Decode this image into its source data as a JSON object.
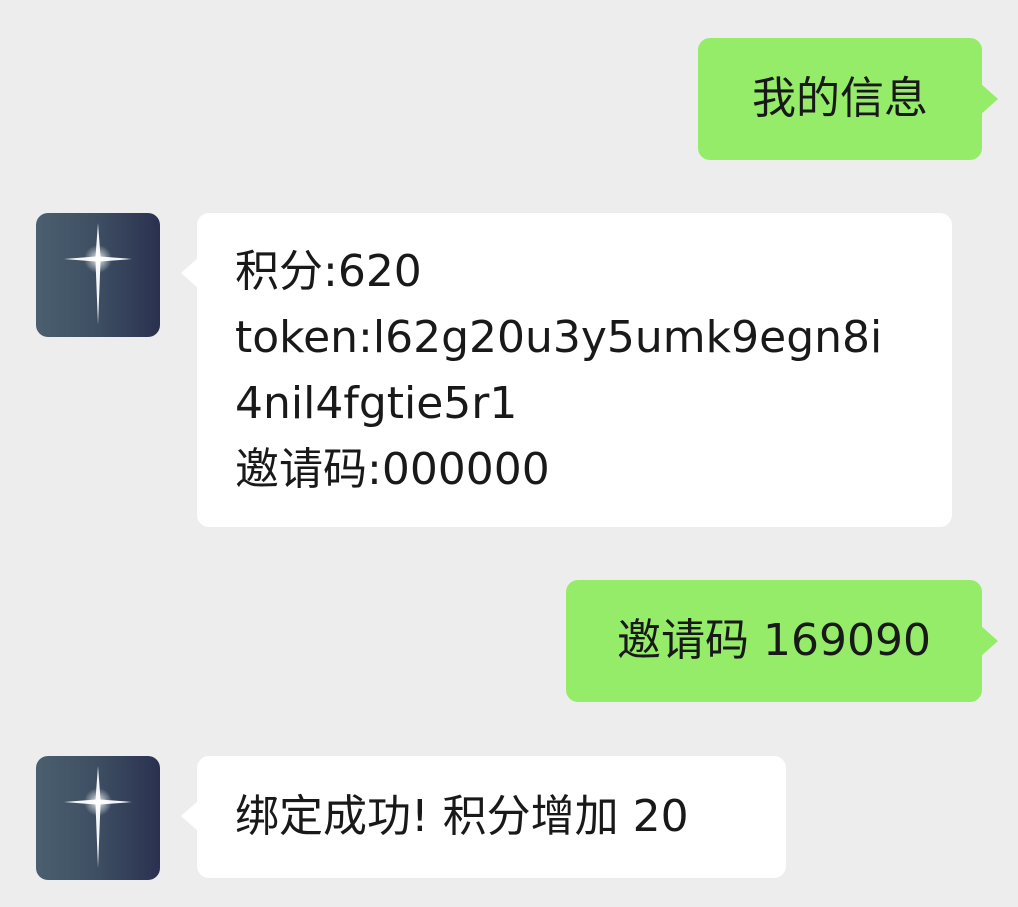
{
  "chat": {
    "messages": [
      {
        "sender": "self",
        "text": "我的信息"
      },
      {
        "sender": "bot",
        "avatar_icon": "sparkle-star-icon",
        "lines": [
          "积分:620",
          "token:l62g20u3y5umk9egn8i",
          "4nil4fgtie5r1",
          "邀请码:000000"
        ]
      },
      {
        "sender": "self",
        "text": "邀请码 169090"
      },
      {
        "sender": "bot",
        "avatar_icon": "sparkle-star-icon",
        "text": "绑定成功! 积分增加 20"
      }
    ]
  },
  "colors": {
    "background": "#ededed",
    "self_bubble": "#95ec69",
    "bot_bubble": "#ffffff",
    "text": "#191919"
  }
}
